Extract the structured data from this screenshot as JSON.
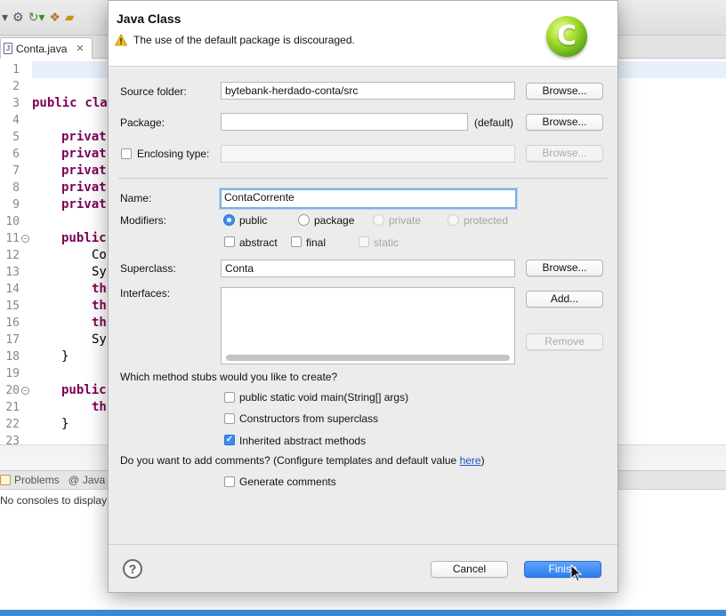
{
  "ide": {
    "editor_tab": "Conta.java",
    "line_numbers": [
      "1",
      "2",
      "3",
      "4",
      "5",
      "6",
      "7",
      "8",
      "9",
      "10",
      "11",
      "12",
      "13",
      "14",
      "15",
      "16",
      "17",
      "18",
      "19",
      "20",
      "21",
      "22",
      "23"
    ],
    "code": {
      "line3_kw": "public",
      "line3_rest": " clas",
      "private_kw": "privat",
      "line11_kw": "public",
      "line12": "Co",
      "line13": "Sy",
      "line14": "th",
      "line15": "th",
      "line16": "th",
      "line17": "Sy",
      "line18": "}",
      "line20_kw": "public",
      "line21": "th",
      "line22": "}"
    },
    "console_tabs": [
      "Problems",
      "Java"
    ],
    "console_message": "No consoles to display"
  },
  "dialog": {
    "title": "Java Class",
    "message": "The use of the default package is discouraged.",
    "logo_letter": "C",
    "source_folder": {
      "label": "Source folder:",
      "value": "bytebank-herdado-conta/src",
      "browse": "Browse..."
    },
    "package": {
      "label": "Package:",
      "value": "",
      "hint": "(default)",
      "browse": "Browse..."
    },
    "enclosing": {
      "label": "Enclosing type:",
      "value": "",
      "browse": "Browse..."
    },
    "name": {
      "label": "Name:",
      "value": "ContaCorrente"
    },
    "modifiers": {
      "label": "Modifiers:",
      "public": "public",
      "package": "package",
      "private": "private",
      "protected": "protected",
      "abstract": "abstract",
      "final": "final",
      "static": "static"
    },
    "superclass": {
      "label": "Superclass:",
      "value": "Conta",
      "browse": "Browse..."
    },
    "interfaces": {
      "label": "Interfaces:",
      "add": "Add...",
      "remove": "Remove"
    },
    "stubs": {
      "question": "Which method stubs would you like to create?",
      "main": "public static void main(String[] args)",
      "constructors": "Constructors from superclass",
      "inherited": "Inherited abstract methods"
    },
    "comments": {
      "question": "Do you want to add comments? (Configure templates and default value ",
      "link": "here",
      "close": ")",
      "generate": "Generate comments"
    },
    "buttons": {
      "cancel": "Cancel",
      "finish": "Finish"
    }
  }
}
